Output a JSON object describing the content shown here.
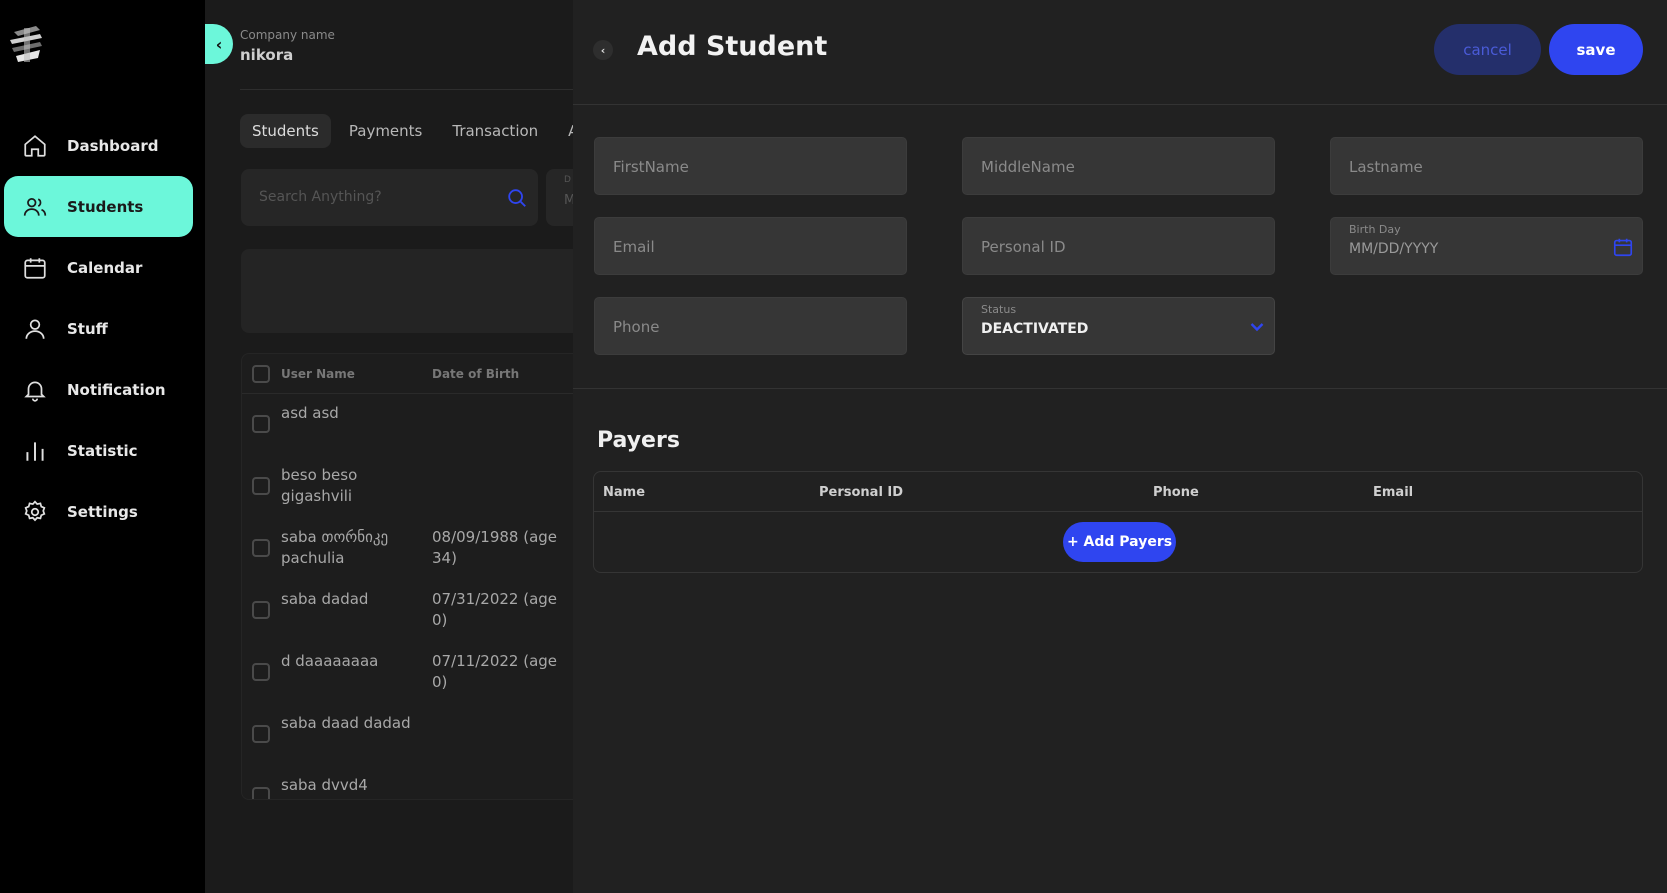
{
  "company": {
    "label": "Company name",
    "name": "nikora"
  },
  "sidebar": {
    "items": [
      {
        "label": "Dashboard",
        "icon": "home-icon",
        "active": false
      },
      {
        "label": "Students",
        "icon": "users-icon",
        "active": true
      },
      {
        "label": "Calendar",
        "icon": "calendar-icon",
        "active": false
      },
      {
        "label": "Stuff",
        "icon": "user-icon",
        "active": false
      },
      {
        "label": "Notification",
        "icon": "bell-icon",
        "active": false
      },
      {
        "label": "Statistic",
        "icon": "bar-chart-icon",
        "active": false
      },
      {
        "label": "Settings",
        "icon": "gear-icon",
        "active": false
      }
    ]
  },
  "tabs": [
    "Students",
    "Payments",
    "Transaction",
    "At"
  ],
  "search": {
    "placeholder": "Search Anything?"
  },
  "filter": {
    "label": "D",
    "value": "M"
  },
  "student_table": {
    "columns": [
      "User Name",
      "Date of Birth"
    ],
    "rows": [
      {
        "name": "asd asd",
        "dob": ""
      },
      {
        "name": "beso beso gigashvili",
        "dob": ""
      },
      {
        "name": "saba თორნიკე pachulia",
        "dob": "08/09/1988 (age 34)"
      },
      {
        "name": "saba dadad",
        "dob": "07/31/2022 (age 0)"
      },
      {
        "name": "d daaaaaaaa",
        "dob": "07/11/2022 (age 0)"
      },
      {
        "name": "saba daad dadad",
        "dob": ""
      },
      {
        "name": "saba dvvd4",
        "dob": ""
      }
    ]
  },
  "drawer": {
    "title": "Add Student",
    "cancel_label": "cancel",
    "save_label": "save",
    "fields": {
      "firstname": "FirstName",
      "middlename": "MiddleName",
      "lastname": "Lastname",
      "email": "Email",
      "personal_id": "Personal ID",
      "birthday_label": "Birth Day",
      "birthday_placeholder": "MM/DD/YYYY",
      "phone": "Phone",
      "status_label": "Status",
      "status_value": "DEACTIVATED"
    },
    "payers": {
      "title": "Payers",
      "columns": [
        "Name",
        "Personal ID",
        "Phone",
        "Email"
      ],
      "add_label": "+ Add Payers"
    }
  },
  "colors": {
    "accent": "#6cf7da",
    "primary": "#2f45f0",
    "panel": "#212121"
  }
}
